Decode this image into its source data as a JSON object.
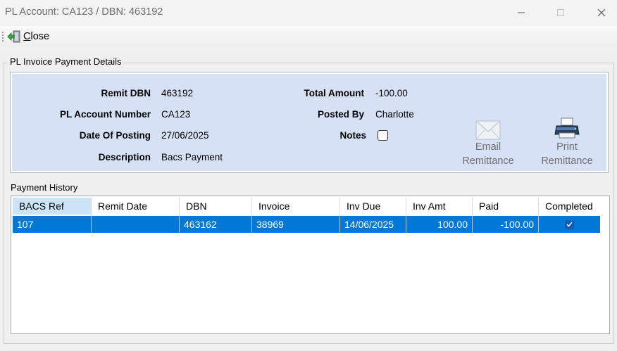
{
  "window": {
    "title": "PL Account: CA123   /   DBN: 463192"
  },
  "toolbar": {
    "close_label_first": "C",
    "close_label_rest": "lose"
  },
  "details": {
    "group_title": "PL Invoice Payment  Details",
    "remit_dbn_label": "Remit DBN",
    "remit_dbn_value": "463192",
    "pl_account_label": "PL Account Number",
    "pl_account_value": "CA123",
    "date_posting_label": "Date Of Posting",
    "date_posting_value": "27/06/2025",
    "description_label": "Description",
    "description_value": "Bacs Payment",
    "total_amount_label": "Total Amount",
    "total_amount_value": "-100.00",
    "posted_by_label": "Posted By",
    "posted_by_value": "Charlotte",
    "notes_label": "Notes",
    "notes_checked": false
  },
  "actions": {
    "email_line1": "Email",
    "email_line2": "Remittance",
    "print_line1": "Print",
    "print_line2": "Remittance"
  },
  "payment_history": {
    "title": "Payment History",
    "columns": [
      "BACS Ref",
      "Remit Date",
      "DBN",
      "Invoice",
      "Inv Due",
      "Inv Amt",
      "Paid",
      "Completed"
    ],
    "rows": [
      {
        "bacs_ref": "107",
        "remit_date": "",
        "dbn": "463162",
        "invoice": "38969",
        "inv_due": "14/06/2025",
        "inv_amt": "100.00",
        "paid": "-100.00",
        "completed": true
      }
    ]
  },
  "colors": {
    "panel_bg": "#d6e1f6",
    "selection": "#0078d7",
    "header_active": "#cce4f7"
  }
}
